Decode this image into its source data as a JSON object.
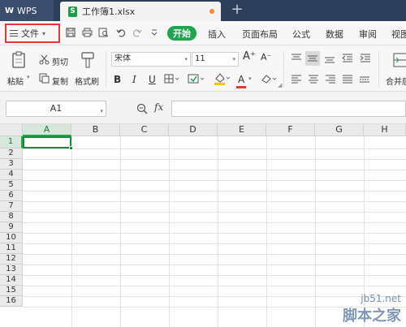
{
  "titlebar": {
    "app_tab": {
      "logo": "W",
      "name": "WPS"
    },
    "doc_tab": {
      "icon_letter": "S",
      "name": "工作簿1.xlsx"
    },
    "new_tab": "+"
  },
  "menu": {
    "file_label": "文件",
    "start_label": "开始",
    "items": [
      "插入",
      "页面布局",
      "公式",
      "数据",
      "审阅",
      "视图"
    ]
  },
  "ribbon": {
    "paste_label": "粘贴",
    "cut_label": "剪切",
    "copy_label": "复制",
    "format_painter_label": "格式刷",
    "font_name": "宋体",
    "font_size": "11",
    "bold": "B",
    "italic": "I",
    "underline": "U",
    "font_color_glyph": "A",
    "grow_font": "A⁺",
    "shrink_font": "A⁻",
    "merge_label": "合并居",
    "accent_color": "#1ea54d",
    "font_color": "#e53535",
    "fill_color": "#f5c400"
  },
  "formula_bar": {
    "cell_ref": "A1",
    "fx_label": "fx",
    "formula": ""
  },
  "grid": {
    "columns": [
      "A",
      "B",
      "C",
      "D",
      "E",
      "F",
      "G",
      "H"
    ],
    "rows": [
      "1",
      "2",
      "3",
      "4",
      "5",
      "6",
      "7",
      "8",
      "9",
      "10",
      "11",
      "12",
      "13",
      "14",
      "15",
      "16"
    ],
    "selected_cell": "A1"
  },
  "watermark": {
    "site": "jb51.net",
    "text": "脚本之家"
  }
}
